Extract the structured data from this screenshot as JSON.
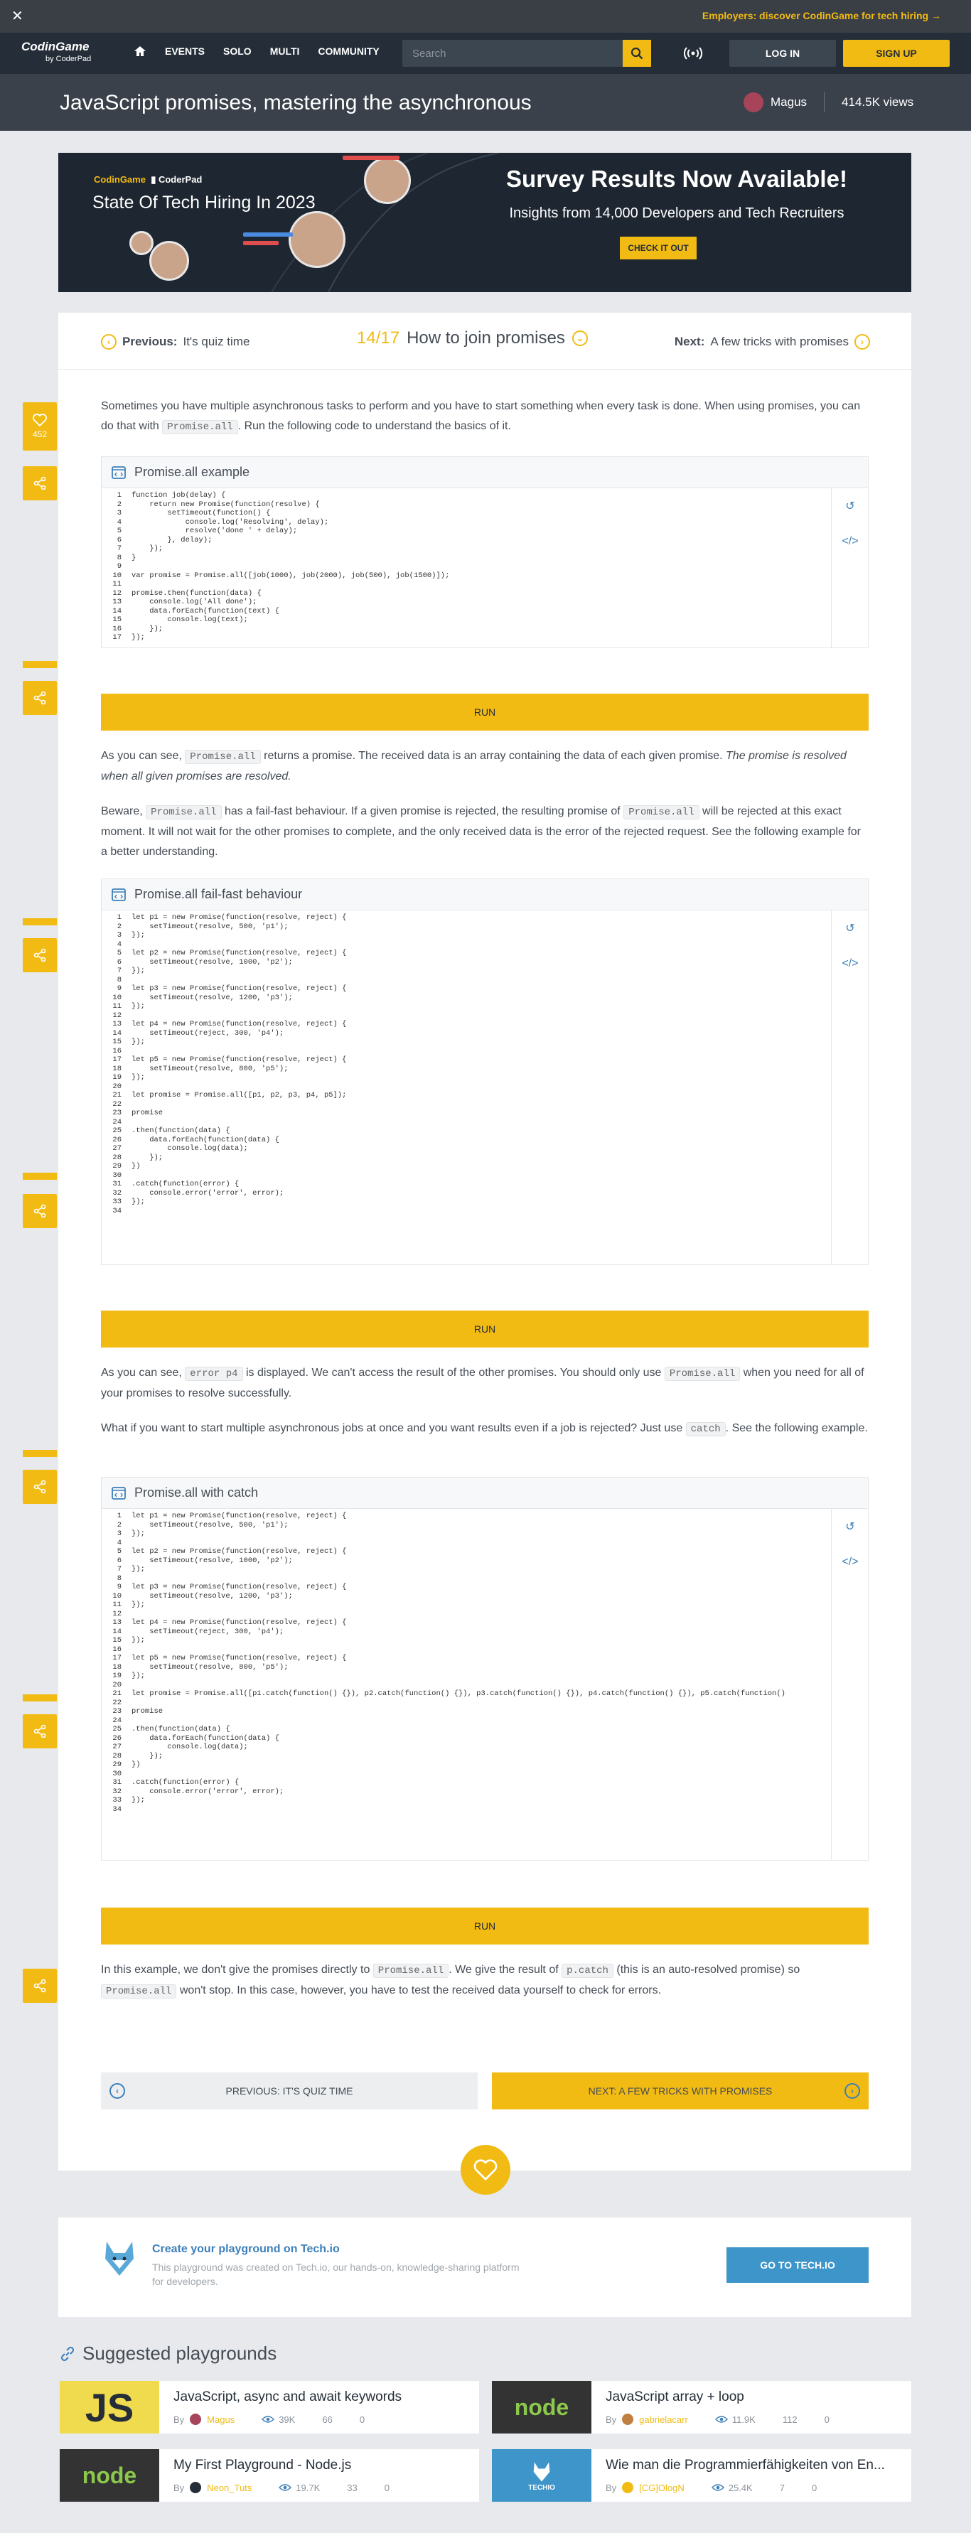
{
  "banner": {
    "close": "✕",
    "promo": "Employers: discover CodinGame for tech hiring →"
  },
  "nav": {
    "logo_main": "CodinGame",
    "logo_sub": "by CoderPad",
    "links": [
      "EVENTS",
      "SOLO",
      "MULTI",
      "COMMUNITY"
    ],
    "search_placeholder": "Search",
    "login": "LOG IN",
    "signup": "SIGN UP"
  },
  "header": {
    "title": "JavaScript promises, mastering the asynchronous",
    "author": "Magus",
    "views": "414.5K views"
  },
  "ad": {
    "brand": "CodinGame",
    "brand2": "CoderPad",
    "hiring": "State Of Tech Hiring In 2023",
    "title": "Survey Results Now Available!",
    "subtitle": "Insights from 14,000 Developers and Tech Recruiters",
    "cta": "CHECK IT OUT"
  },
  "lesson_nav": {
    "prev_label": "Previous:",
    "prev_title": "It's quiz time",
    "counter": "14/17",
    "current": "How to join promises",
    "next_label": "Next:",
    "next_title": "A few tricks with promises"
  },
  "likes": "452",
  "paragraphs": {
    "p1a": "Sometimes you have multiple asynchronous tasks to perform and you have to start something when every task is done. When using promises, you can do that with ",
    "p1code": "Promise.all",
    "p1b": ". Run the following code to understand the basics of it.",
    "p2a": "As you can see, ",
    "p2code": "Promise.all",
    "p2b": " returns a promise. The received data is an array containing the data of each given promise. ",
    "p2i": "The promise is resolved when all given promises are resolved.",
    "p3a": "Beware, ",
    "p3code": "Promise.all",
    "p3b": " has a fail-fast behaviour. If a given promise is rejected, the resulting promise of ",
    "p3code2": "Promise.all",
    "p3c": " will be rejected at this exact moment. It will not wait for the other promises to complete, and the only received data is the error of the rejected request. See the following example for a better understanding.",
    "p4a": "As you can see, ",
    "p4code": "error p4",
    "p4b": " is displayed. We can't access the result of the other promises. You should only use ",
    "p4code2": "Promise.all",
    "p4c": " when you need for all of your promises to resolve successfully.",
    "p5a": "What if you want to start multiple asynchronous jobs at once and you want results even if a job is rejected? Just use ",
    "p5code": "catch",
    "p5b": ". See the following example.",
    "p6a": "In this example, we don't give the promises directly to ",
    "p6code": "Promise.all",
    "p6b": ". We give the result of ",
    "p6code2": "p.catch",
    "p6c": " (this is an auto-resolved promise) so ",
    "p6code3": "Promise.all",
    "p6d": " won't stop. In this case, however, you have to test the received data yourself to check for errors."
  },
  "widgets": [
    {
      "title": "Promise.all example",
      "run": "RUN",
      "lines": [
        {
          "n": "1",
          "t": "function job(delay) {"
        },
        {
          "n": "2",
          "t": "    return new Promise(function(resolve) {"
        },
        {
          "n": "3",
          "t": "        setTimeout(function() {"
        },
        {
          "n": "4",
          "t": "            console.log('Resolving', delay);"
        },
        {
          "n": "5",
          "t": "            resolve('done ' + delay);"
        },
        {
          "n": "6",
          "t": "        }, delay);"
        },
        {
          "n": "7",
          "t": "    });"
        },
        {
          "n": "8",
          "t": "}"
        },
        {
          "n": "9",
          "t": ""
        },
        {
          "n": "10",
          "t": "var promise = Promise.all([job(1000), job(2000), job(500), job(1500)]);"
        },
        {
          "n": "11",
          "t": ""
        },
        {
          "n": "12",
          "t": "promise.then(function(data) {"
        },
        {
          "n": "13",
          "t": "    console.log('All done');"
        },
        {
          "n": "14",
          "t": "    data.forEach(function(text) {"
        },
        {
          "n": "15",
          "t": "        console.log(text);"
        },
        {
          "n": "16",
          "t": "    });"
        },
        {
          "n": "17",
          "t": "});"
        }
      ]
    },
    {
      "title": "Promise.all fail-fast behaviour",
      "run": "RUN",
      "lines": [
        {
          "n": "1",
          "t": "let p1 = new Promise(function(resolve, reject) {"
        },
        {
          "n": "2",
          "t": "    setTimeout(resolve, 500, 'p1');"
        },
        {
          "n": "3",
          "t": "});"
        },
        {
          "n": "4",
          "t": ""
        },
        {
          "n": "5",
          "t": "let p2 = new Promise(function(resolve, reject) {"
        },
        {
          "n": "6",
          "t": "    setTimeout(resolve, 1000, 'p2');"
        },
        {
          "n": "7",
          "t": "});"
        },
        {
          "n": "8",
          "t": ""
        },
        {
          "n": "9",
          "t": "let p3 = new Promise(function(resolve, reject) {"
        },
        {
          "n": "10",
          "t": "    setTimeout(resolve, 1200, 'p3');"
        },
        {
          "n": "11",
          "t": "});"
        },
        {
          "n": "12",
          "t": ""
        },
        {
          "n": "13",
          "t": "let p4 = new Promise(function(resolve, reject) {"
        },
        {
          "n": "14",
          "t": "    setTimeout(reject, 300, 'p4');"
        },
        {
          "n": "15",
          "t": "});"
        },
        {
          "n": "16",
          "t": ""
        },
        {
          "n": "17",
          "t": "let p5 = new Promise(function(resolve, reject) {"
        },
        {
          "n": "18",
          "t": "    setTimeout(resolve, 800, 'p5');"
        },
        {
          "n": "19",
          "t": "});"
        },
        {
          "n": "20",
          "t": ""
        },
        {
          "n": "21",
          "t": "let promise = Promise.all([p1, p2, p3, p4, p5]);"
        },
        {
          "n": "22",
          "t": ""
        },
        {
          "n": "23",
          "t": "promise"
        },
        {
          "n": "24",
          "t": ""
        },
        {
          "n": "25",
          "t": ".then(function(data) {"
        },
        {
          "n": "26",
          "t": "    data.forEach(function(data) {"
        },
        {
          "n": "27",
          "t": "        console.log(data);"
        },
        {
          "n": "28",
          "t": "    });"
        },
        {
          "n": "29",
          "t": "})"
        },
        {
          "n": "30",
          "t": ""
        },
        {
          "n": "31",
          "t": ".catch(function(error) {"
        },
        {
          "n": "32",
          "t": "    console.error('error', error);"
        },
        {
          "n": "33",
          "t": "});"
        },
        {
          "n": "34",
          "t": ""
        }
      ]
    },
    {
      "title": "Promise.all with catch",
      "run": "RUN",
      "lines": [
        {
          "n": "1",
          "t": "let p1 = new Promise(function(resolve, reject) {"
        },
        {
          "n": "2",
          "t": "    setTimeout(resolve, 500, 'p1');"
        },
        {
          "n": "3",
          "t": "});"
        },
        {
          "n": "4",
          "t": ""
        },
        {
          "n": "5",
          "t": "let p2 = new Promise(function(resolve, reject) {"
        },
        {
          "n": "6",
          "t": "    setTimeout(resolve, 1000, 'p2');"
        },
        {
          "n": "7",
          "t": "});"
        },
        {
          "n": "8",
          "t": ""
        },
        {
          "n": "9",
          "t": "let p3 = new Promise(function(resolve, reject) {"
        },
        {
          "n": "10",
          "t": "    setTimeout(resolve, 1200, 'p3');"
        },
        {
          "n": "11",
          "t": "});"
        },
        {
          "n": "12",
          "t": ""
        },
        {
          "n": "13",
          "t": "let p4 = new Promise(function(resolve, reject) {"
        },
        {
          "n": "14",
          "t": "    setTimeout(reject, 300, 'p4');"
        },
        {
          "n": "15",
          "t": "});"
        },
        {
          "n": "16",
          "t": ""
        },
        {
          "n": "17",
          "t": "let p5 = new Promise(function(resolve, reject) {"
        },
        {
          "n": "18",
          "t": "    setTimeout(resolve, 800, 'p5');"
        },
        {
          "n": "19",
          "t": "});"
        },
        {
          "n": "20",
          "t": ""
        },
        {
          "n": "21",
          "t": "let promise = Promise.all([p1.catch(function() {}), p2.catch(function() {}), p3.catch(function() {}), p4.catch(function() {}), p5.catch(function()"
        },
        {
          "n": "22",
          "t": ""
        },
        {
          "n": "23",
          "t": "promise"
        },
        {
          "n": "24",
          "t": ""
        },
        {
          "n": "25",
          "t": ".then(function(data) {"
        },
        {
          "n": "26",
          "t": "    data.forEach(function(data) {"
        },
        {
          "n": "27",
          "t": "        console.log(data);"
        },
        {
          "n": "28",
          "t": "    });"
        },
        {
          "n": "29",
          "t": "})"
        },
        {
          "n": "30",
          "t": ""
        },
        {
          "n": "31",
          "t": ".catch(function(error) {"
        },
        {
          "n": "32",
          "t": "    console.error('error', error);"
        },
        {
          "n": "33",
          "t": "});"
        },
        {
          "n": "34",
          "t": ""
        }
      ]
    }
  ],
  "bottom_nav": {
    "prev": "PREVIOUS: IT'S QUIZ TIME",
    "next": "NEXT: A FEW TRICKS WITH PROMISES"
  },
  "techio": {
    "heading": "Create your playground on Tech.io",
    "desc": "This playground was created on Tech.io, our hands-on, knowledge-sharing platform for developers.",
    "button": "GO TO TECH.IO"
  },
  "suggested": {
    "title": "Suggested playgrounds",
    "items": [
      {
        "title": "JavaScript, async and await keywords",
        "by": "By",
        "author": "Magus",
        "views": "39K",
        "likes": "66",
        "comments": "0",
        "thumb": "JS"
      },
      {
        "title": "JavaScript array + loop",
        "by": "By",
        "author": "gabrielacarr",
        "views": "11.9K",
        "likes": "112",
        "comments": "0",
        "thumb": "node"
      },
      {
        "title": "My First Playground - Node.js",
        "by": "By",
        "author": "Neon_Tuts",
        "views": "19.7K",
        "likes": "33",
        "comments": "0",
        "thumb": "node"
      },
      {
        "title": "Wie man die Programmierfähigkeiten von En...",
        "by": "By",
        "author": "[CG]OlogN",
        "views": "25.4K",
        "likes": "7",
        "comments": "0",
        "thumb": "TECHIO"
      }
    ]
  },
  "colors": {
    "accent": "#f2bb13",
    "nav_bg": "#252e38",
    "link_blue": "#3d7fba"
  }
}
